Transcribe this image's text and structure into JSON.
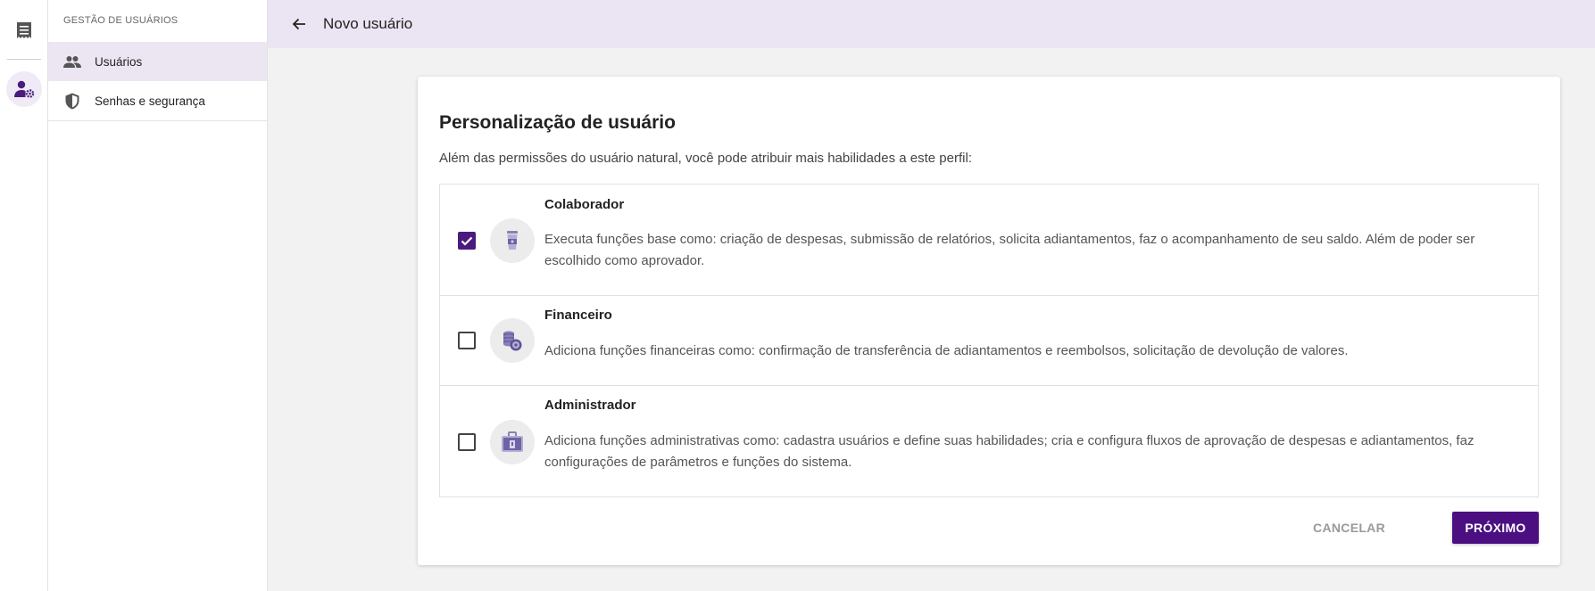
{
  "sidebar": {
    "header": "GESTÃO DE USUÁRIOS",
    "items": [
      {
        "label": "Usuários",
        "icon": "people-icon",
        "active": true
      },
      {
        "label": "Senhas e segurança",
        "icon": "shield-icon",
        "active": false
      }
    ]
  },
  "rail": {
    "items": [
      {
        "icon": "document-list-icon"
      },
      {
        "icon": "user-settings-icon",
        "active": true
      }
    ]
  },
  "header": {
    "back_icon": "arrow-left-icon",
    "title": "Novo usuário"
  },
  "card": {
    "title": "Personalização de usuário",
    "subtitle": "Além das permissões do usuário natural, você pode atribuir mais habilidades a este perfil:",
    "options": [
      {
        "title": "Colaborador",
        "description": "Executa funções base como: criação de despesas, submissão de relatórios, solicita adiantamentos, faz o acompanhamento de seu saldo. Além de poder ser escolhido como aprovador.",
        "checked": true,
        "icon": "coffee-cup-icon"
      },
      {
        "title": "Financeiro",
        "description": "Adiciona funções financeiras como: confirmação de transferência de adiantamentos e reembolsos, solicitação de devolução de valores.",
        "checked": false,
        "icon": "coins-icon"
      },
      {
        "title": "Administrador",
        "description": "Adiciona funções administrativas como: cadastra usuários e define suas habilidades; cria e configura fluxos de aprovação de despesas e adiantamentos, faz configurações de parâmetros e funções do sistema.",
        "checked": false,
        "icon": "briefcase-icon"
      }
    ],
    "cancel_label": "CANCELAR",
    "next_label": "PRÓXIMO"
  },
  "colors": {
    "accent": "#4b0f82",
    "header_bg": "#ebe4f2",
    "active_item_bg": "#ece6f3"
  }
}
